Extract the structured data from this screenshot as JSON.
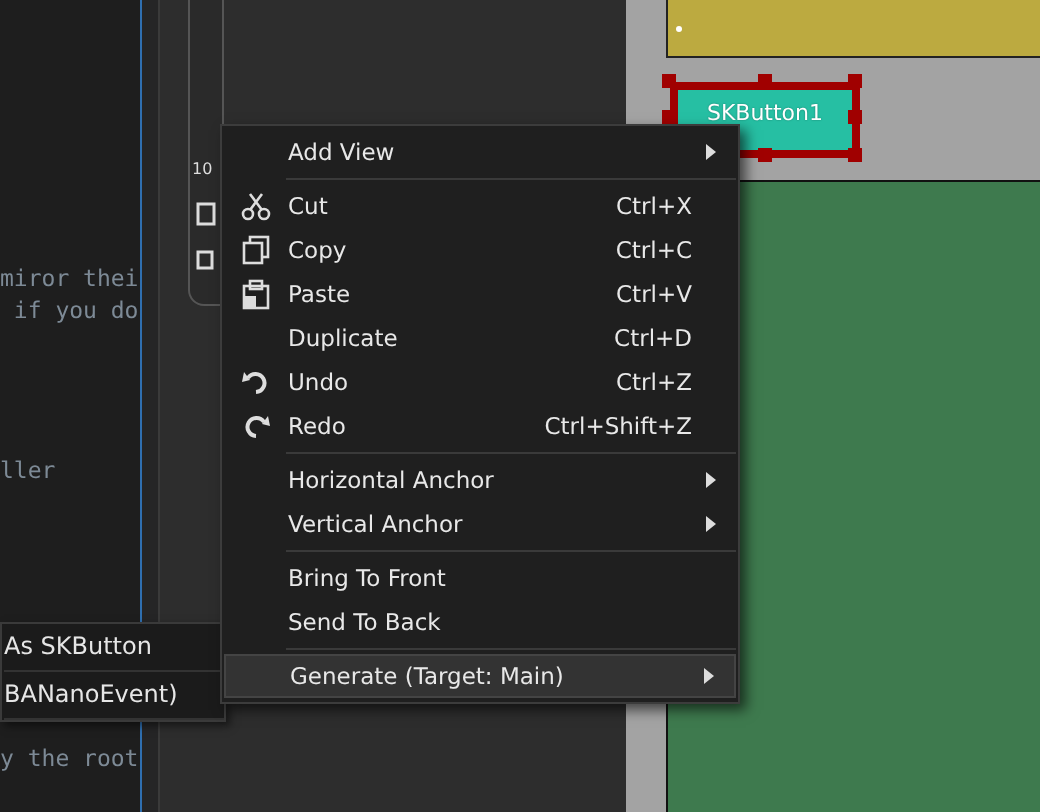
{
  "code_editor": {
    "lines": [
      {
        "text": "miror thei"
      },
      {
        "text": " if you do"
      },
      {
        "text": "ller"
      },
      {
        "text": "y the root"
      }
    ]
  },
  "toolbar": {
    "label": "10"
  },
  "designer": {
    "button": {
      "label": "SKButton1",
      "selected": true
    }
  },
  "submenu": {
    "items": [
      {
        "label": "As SKButton"
      },
      {
        "label": "BANanoEvent)"
      }
    ]
  },
  "context_menu": {
    "items": [
      {
        "kind": "item",
        "label": "Add View",
        "submenu": true,
        "selected": false
      },
      {
        "kind": "separator"
      },
      {
        "kind": "item",
        "label": "Cut",
        "shortcut": "Ctrl+X",
        "selected": false
      },
      {
        "kind": "item",
        "label": "Copy",
        "shortcut": "Ctrl+C",
        "selected": false
      },
      {
        "kind": "item",
        "label": "Paste",
        "shortcut": "Ctrl+V",
        "selected": false
      },
      {
        "kind": "item",
        "label": "Duplicate",
        "shortcut": "Ctrl+D",
        "selected": false
      },
      {
        "kind": "item",
        "label": "Undo",
        "shortcut": "Ctrl+Z",
        "selected": false
      },
      {
        "kind": "item",
        "label": "Redo",
        "shortcut": "Ctrl+Shift+Z",
        "selected": false
      },
      {
        "kind": "separator"
      },
      {
        "kind": "item",
        "label": "Horizontal Anchor",
        "submenu": true,
        "selected": false
      },
      {
        "kind": "item",
        "label": "Vertical Anchor",
        "submenu": true,
        "selected": false
      },
      {
        "kind": "separator"
      },
      {
        "kind": "item",
        "label": "Bring To Front",
        "selected": false
      },
      {
        "kind": "item",
        "label": "Send To Back",
        "selected": false
      },
      {
        "kind": "separator"
      },
      {
        "kind": "item",
        "label": "Generate (Target: Main)",
        "submenu": true,
        "selected": true
      }
    ]
  }
}
